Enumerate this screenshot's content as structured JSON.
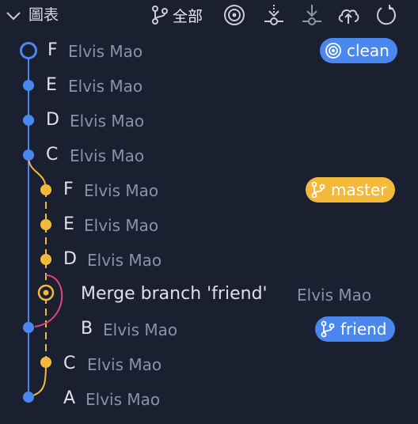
{
  "header": {
    "title": "圖表",
    "branch_filter_label": "全部",
    "icons": [
      "chevron-down-icon",
      "git-branch-icon",
      "target-icon",
      "fetch-icon",
      "pull-icon",
      "cloud-upload-icon",
      "refresh-icon"
    ]
  },
  "colors": {
    "background": "#1b2030",
    "blue_lane": "#4a88f0",
    "yellow_lane": "#f3b93b",
    "merge_link": "#e0457b"
  },
  "commits": [
    {
      "message": "F",
      "author": "Elvis Mao",
      "lane": "blue",
      "node": "head"
    },
    {
      "message": "E",
      "author": "Elvis Mao",
      "lane": "blue",
      "node": "dot"
    },
    {
      "message": "D",
      "author": "Elvis Mao",
      "lane": "blue",
      "node": "dot"
    },
    {
      "message": "C",
      "author": "Elvis Mao",
      "lane": "blue",
      "node": "dot"
    },
    {
      "message": "F",
      "author": "Elvis Mao",
      "lane": "yellow",
      "node": "dot"
    },
    {
      "message": "E",
      "author": "Elvis Mao",
      "lane": "yellow",
      "node": "dot"
    },
    {
      "message": "D",
      "author": "Elvis Mao",
      "lane": "yellow",
      "node": "dot"
    },
    {
      "message": "Merge branch 'friend'",
      "author": "Elvis Mao",
      "lane": "yellow",
      "node": "merge"
    },
    {
      "message": "B",
      "author": "Elvis Mao",
      "lane": "blue",
      "node": "dot"
    },
    {
      "message": "C",
      "author": "Elvis Mao",
      "lane": "yellow",
      "node": "dot"
    },
    {
      "message": "A",
      "author": "Elvis Mao",
      "lane": "blue",
      "node": "dot"
    }
  ],
  "badges": {
    "clean": {
      "label": "clean",
      "icon": "target-icon",
      "color": "blue"
    },
    "master": {
      "label": "master",
      "icon": "git-branch-icon",
      "color": "yellow"
    },
    "friend": {
      "label": "friend",
      "icon": "git-branch-icon",
      "color": "blue"
    }
  }
}
